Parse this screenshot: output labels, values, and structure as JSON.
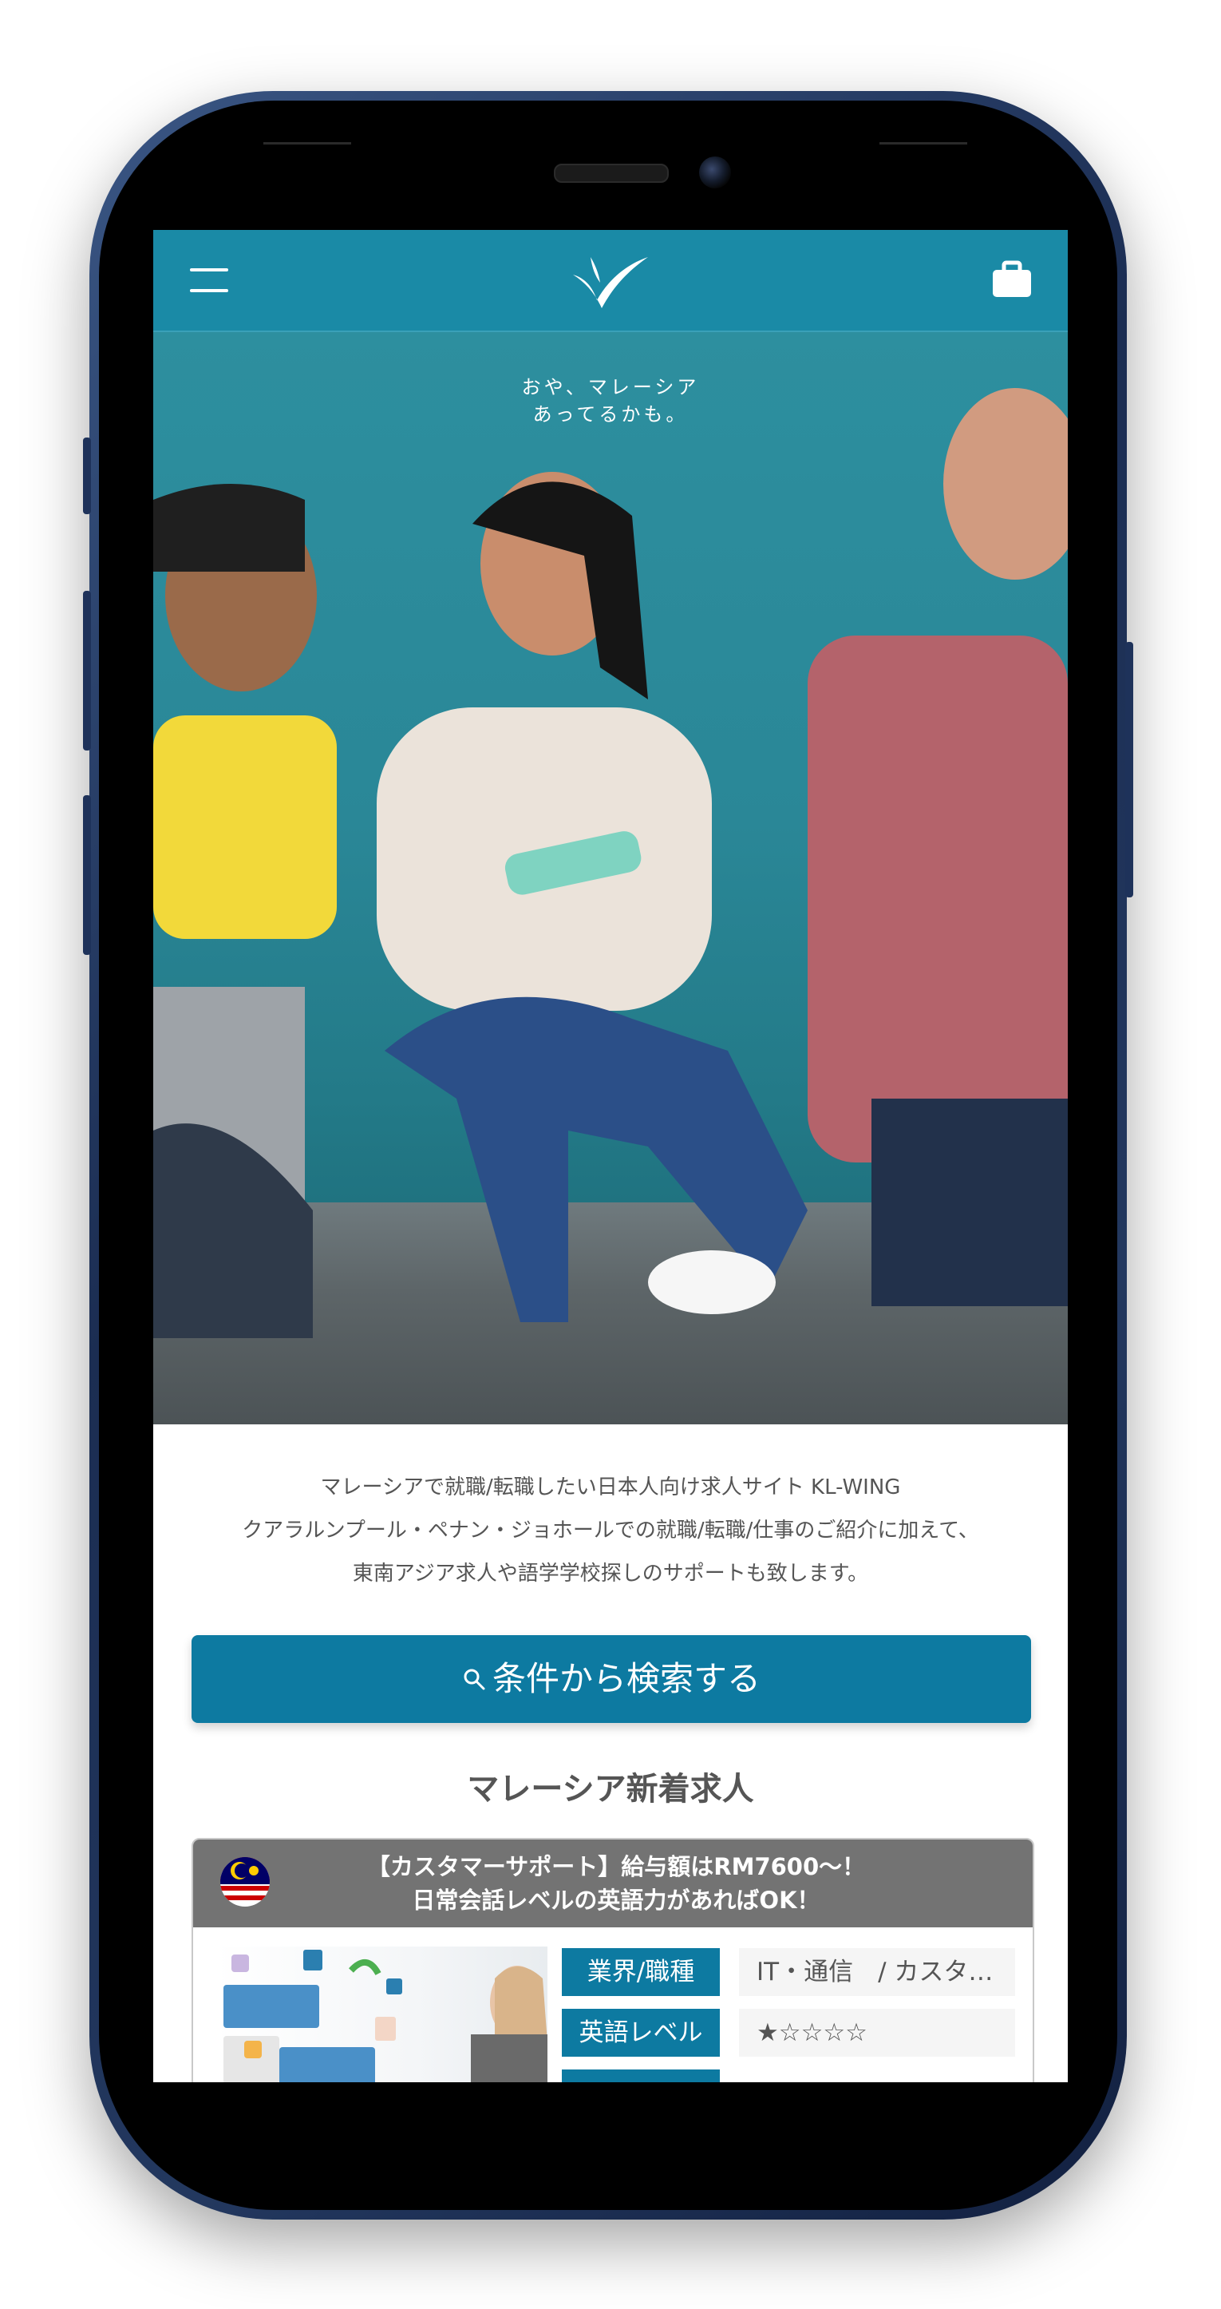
{
  "header": {
    "menu_icon": "hamburger-menu-icon",
    "logo_icon": "bird-logo-icon",
    "bag_icon": "briefcase-icon"
  },
  "hero": {
    "tagline_line1": "おや、マレーシア",
    "tagline_line2": "あってるかも。"
  },
  "intro": {
    "line1": "マレーシアで就職/転職したい日本人向け求人サイト KL-WING",
    "line2": "クアラルンプール・ペナン・ジョホールでの就職/転職/仕事のご紹介に加えて、",
    "line3": "東南アジア求人や語学学校探しのサポートも致します。"
  },
  "search": {
    "label": "条件から検索する",
    "icon": "search-icon"
  },
  "section": {
    "title": "マレーシア新着求人"
  },
  "job": {
    "title_line1": "【カスタマーサポート】給与額はRM7600〜！",
    "title_line2": "日常会話レベルの英語力があればOK！",
    "flag_icon": "malaysia-flag-icon",
    "rows": [
      {
        "key": "業界/職種",
        "value": "IT・通信　/ カスタ…"
      },
      {
        "key": "英語レベル",
        "value": "★☆☆☆☆"
      }
    ]
  },
  "colors": {
    "header": "#1a8aa6",
    "accent": "#0d7aa1",
    "card_header": "#737373"
  }
}
